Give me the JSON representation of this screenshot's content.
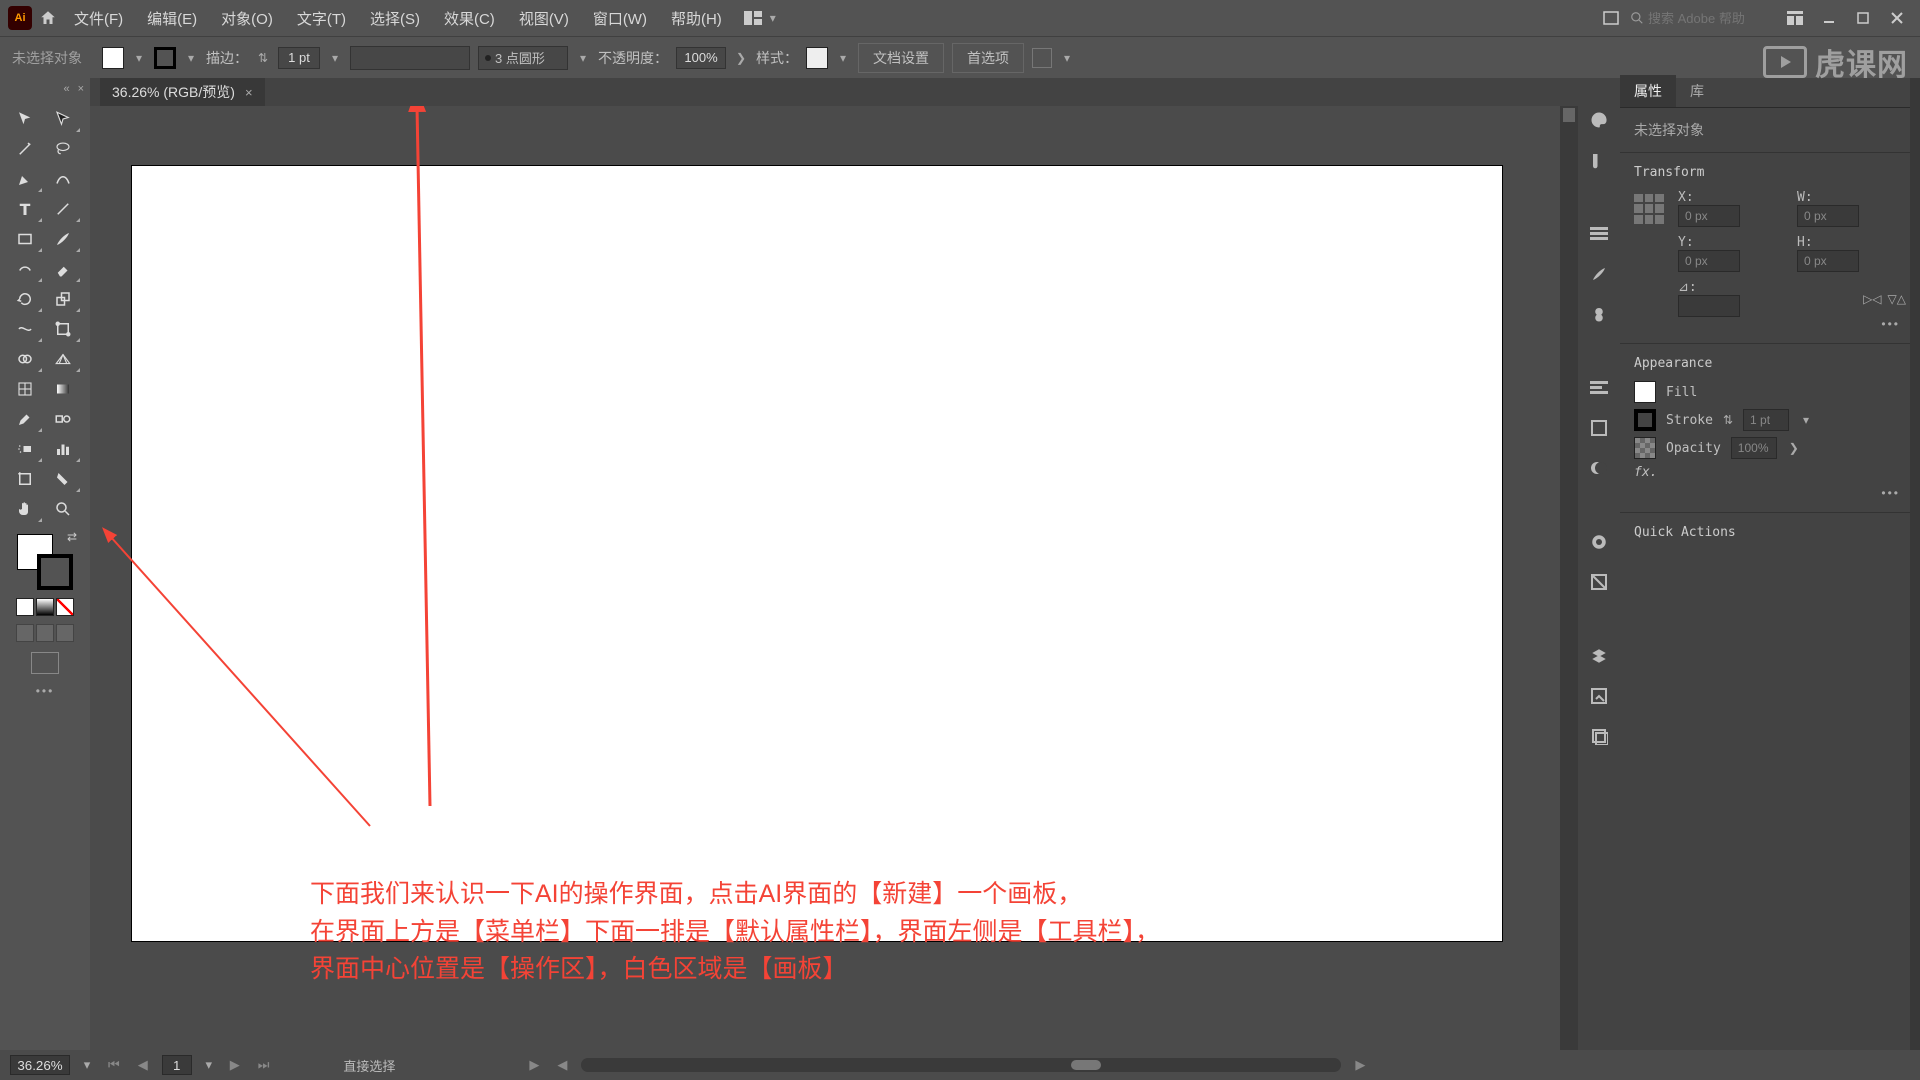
{
  "menubar": {
    "logo": "Ai",
    "items": [
      "文件(F)",
      "编辑(E)",
      "对象(O)",
      "文字(T)",
      "选择(S)",
      "效果(C)",
      "视图(V)",
      "窗口(W)",
      "帮助(H)"
    ],
    "search_placeholder": "搜索 Adobe 帮助"
  },
  "controlbar": {
    "noselect": "未选择对象",
    "stroke_label": "描边：",
    "stroke_value": "1 pt",
    "profile_label": "3 点圆形",
    "opacity_label": "不透明度：",
    "opacity_value": "100%",
    "style_label": "样式：",
    "docsetup": "文档设置",
    "prefs": "首选项"
  },
  "doctab": {
    "title": "36.26% (RGB/预览)"
  },
  "statusbar": {
    "zoom": "36.26%",
    "artboard": "1",
    "toolname": "直接选择"
  },
  "panels": {
    "tab_properties": "属性",
    "tab_libraries": "库",
    "noobj": "未选择对象",
    "transform_title": "Transform",
    "labels": {
      "x": "X:",
      "y": "Y:",
      "w": "W:",
      "h": "H:",
      "angle": "⊿:"
    },
    "vals": {
      "x": "0 px",
      "y": "0 px",
      "w": "0 px",
      "h": "0 px"
    },
    "appearance_title": "Appearance",
    "fill_label": "Fill",
    "stroke_label": "Stroke",
    "stroke_val": "1 pt",
    "opacity_label": "Opacity",
    "opacity_val": "100%",
    "fx": "fx.",
    "quick_title": "Quick Actions"
  },
  "annotation": {
    "line1": "下面我们来认识一下AI的操作界面，点击AI界面的【新建】一个画板，",
    "line2": "在界面上方是【菜单栏】下面一排是【默认属性栏】，界面左侧是【工具栏】，",
    "line3": "界面中心位置是【操作区】，白色区域是【画板】"
  },
  "watermark": "虎课网"
}
